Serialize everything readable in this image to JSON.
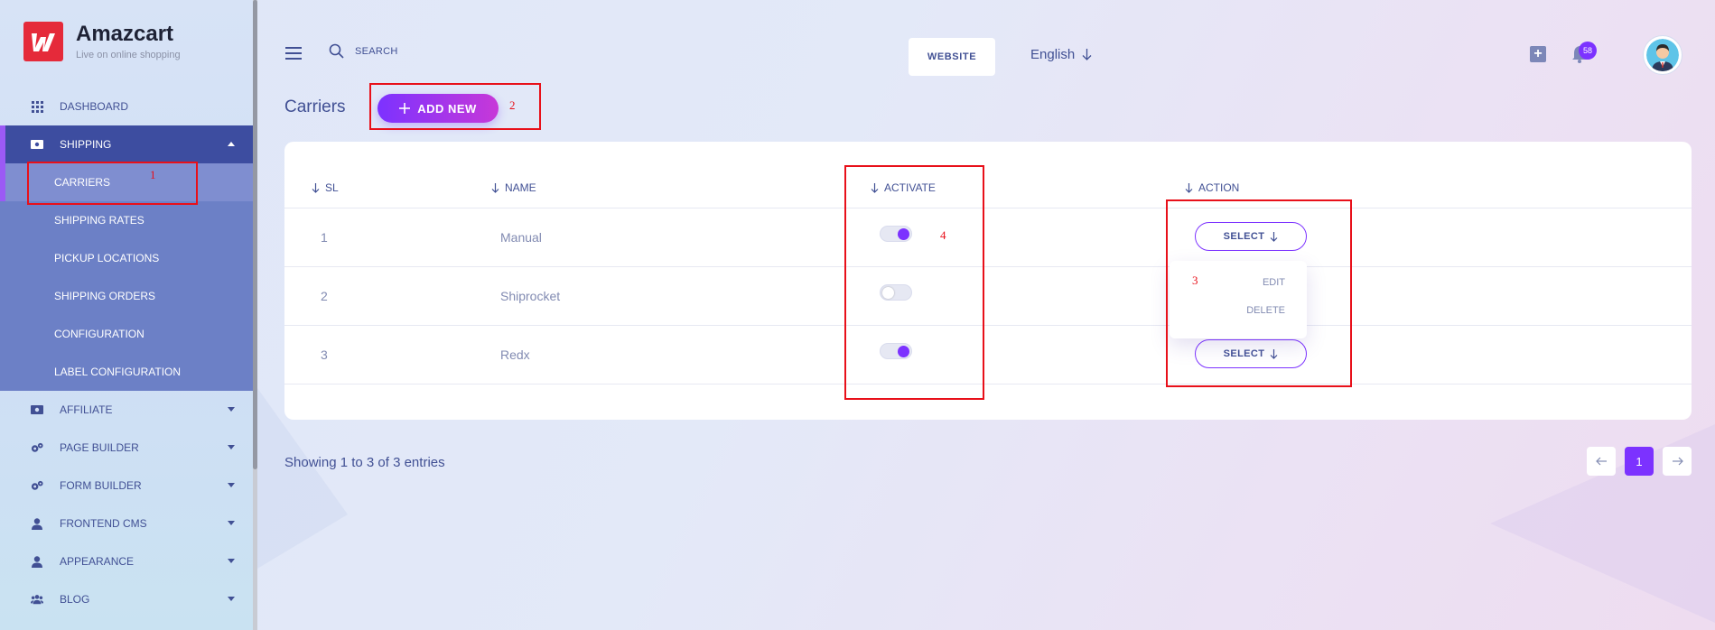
{
  "brand": {
    "name": "Amazcart",
    "tagline": "Live on online shopping"
  },
  "sidebar": {
    "items": [
      {
        "label": "DASHBOARD",
        "icon": "grid-icon"
      },
      {
        "label": "SHIPPING",
        "icon": "money-icon",
        "open": true
      },
      {
        "label": "AFFILIATE",
        "icon": "money-icon"
      },
      {
        "label": "PAGE BUILDER",
        "icon": "gears-icon"
      },
      {
        "label": "FORM BUILDER",
        "icon": "gears-icon"
      },
      {
        "label": "FRONTEND CMS",
        "icon": "user-icon"
      },
      {
        "label": "APPEARANCE",
        "icon": "user-icon"
      },
      {
        "label": "BLOG",
        "icon": "users-icon"
      }
    ],
    "shipping_sub": [
      "CARRIERS",
      "SHIPPING RATES",
      "PICKUP LOCATIONS",
      "SHIPPING ORDERS",
      "CONFIGURATION",
      "LABEL CONFIGURATION"
    ]
  },
  "header": {
    "search_label": "SEARCH",
    "website_label": "WEBSITE",
    "language": "English",
    "notification_count": "58"
  },
  "page": {
    "title": "Carriers",
    "add_new_label": "ADD NEW"
  },
  "table": {
    "columns": [
      "SL",
      "NAME",
      "ACTIVATE",
      "ACTION"
    ],
    "rows": [
      {
        "sl": "1",
        "name": "Manual",
        "active": true,
        "action": "SELECT"
      },
      {
        "sl": "2",
        "name": "Shiprocket",
        "active": false,
        "action": "SELECT"
      },
      {
        "sl": "3",
        "name": "Redx",
        "active": true,
        "action": "SELECT"
      }
    ],
    "dropdown": [
      "EDIT",
      "DELETE"
    ]
  },
  "annotations": [
    "1",
    "2",
    "3",
    "4"
  ],
  "footer": {
    "showing": "Showing 1 to 3 of 3 entries",
    "current_page": "1"
  },
  "colors": {
    "accent": "#7c32ff",
    "sidebar_active": "#3d4da0",
    "annotation": "#e8101a"
  }
}
